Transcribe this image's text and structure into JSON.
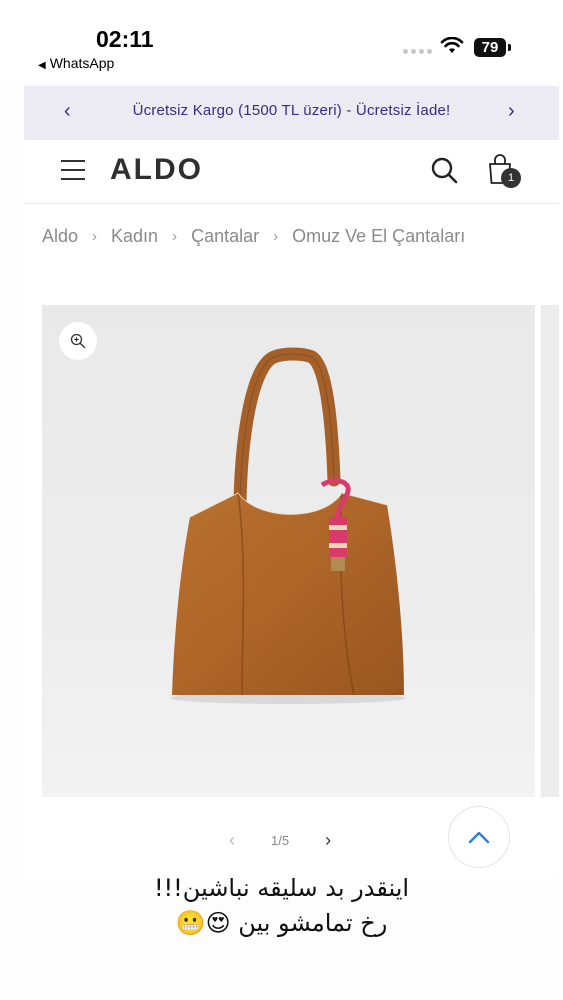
{
  "status_bar": {
    "time": "02:11",
    "back_app": "WhatsApp",
    "battery": "79"
  },
  "promo": {
    "text": "Ücretsiz Kargo (1500 TL üzeri) - Ücretsiz İade!",
    "prev": "‹",
    "next": "›",
    "text_color": "#3a2a8a",
    "background": "#ecebf3"
  },
  "header": {
    "logo": "ALDO",
    "cart_count": "1"
  },
  "breadcrumb": {
    "items": [
      "Aldo",
      "Kadın",
      "Çantalar",
      "Omuz Ve El Çantaları"
    ],
    "separator": "›"
  },
  "gallery": {
    "pager_text": "1/5",
    "prev": "‹",
    "next": "›"
  },
  "caption": {
    "line1": "اینقدر بد سلیقه نباشین!!!",
    "line2": "رخ تمامشو بین 😍😬"
  },
  "icons": {
    "menu": "hamburger-icon",
    "search": "search-icon",
    "cart": "shopping-bag-icon",
    "zoom": "zoom-in-icon",
    "scroll_top": "chevron-up-icon"
  }
}
